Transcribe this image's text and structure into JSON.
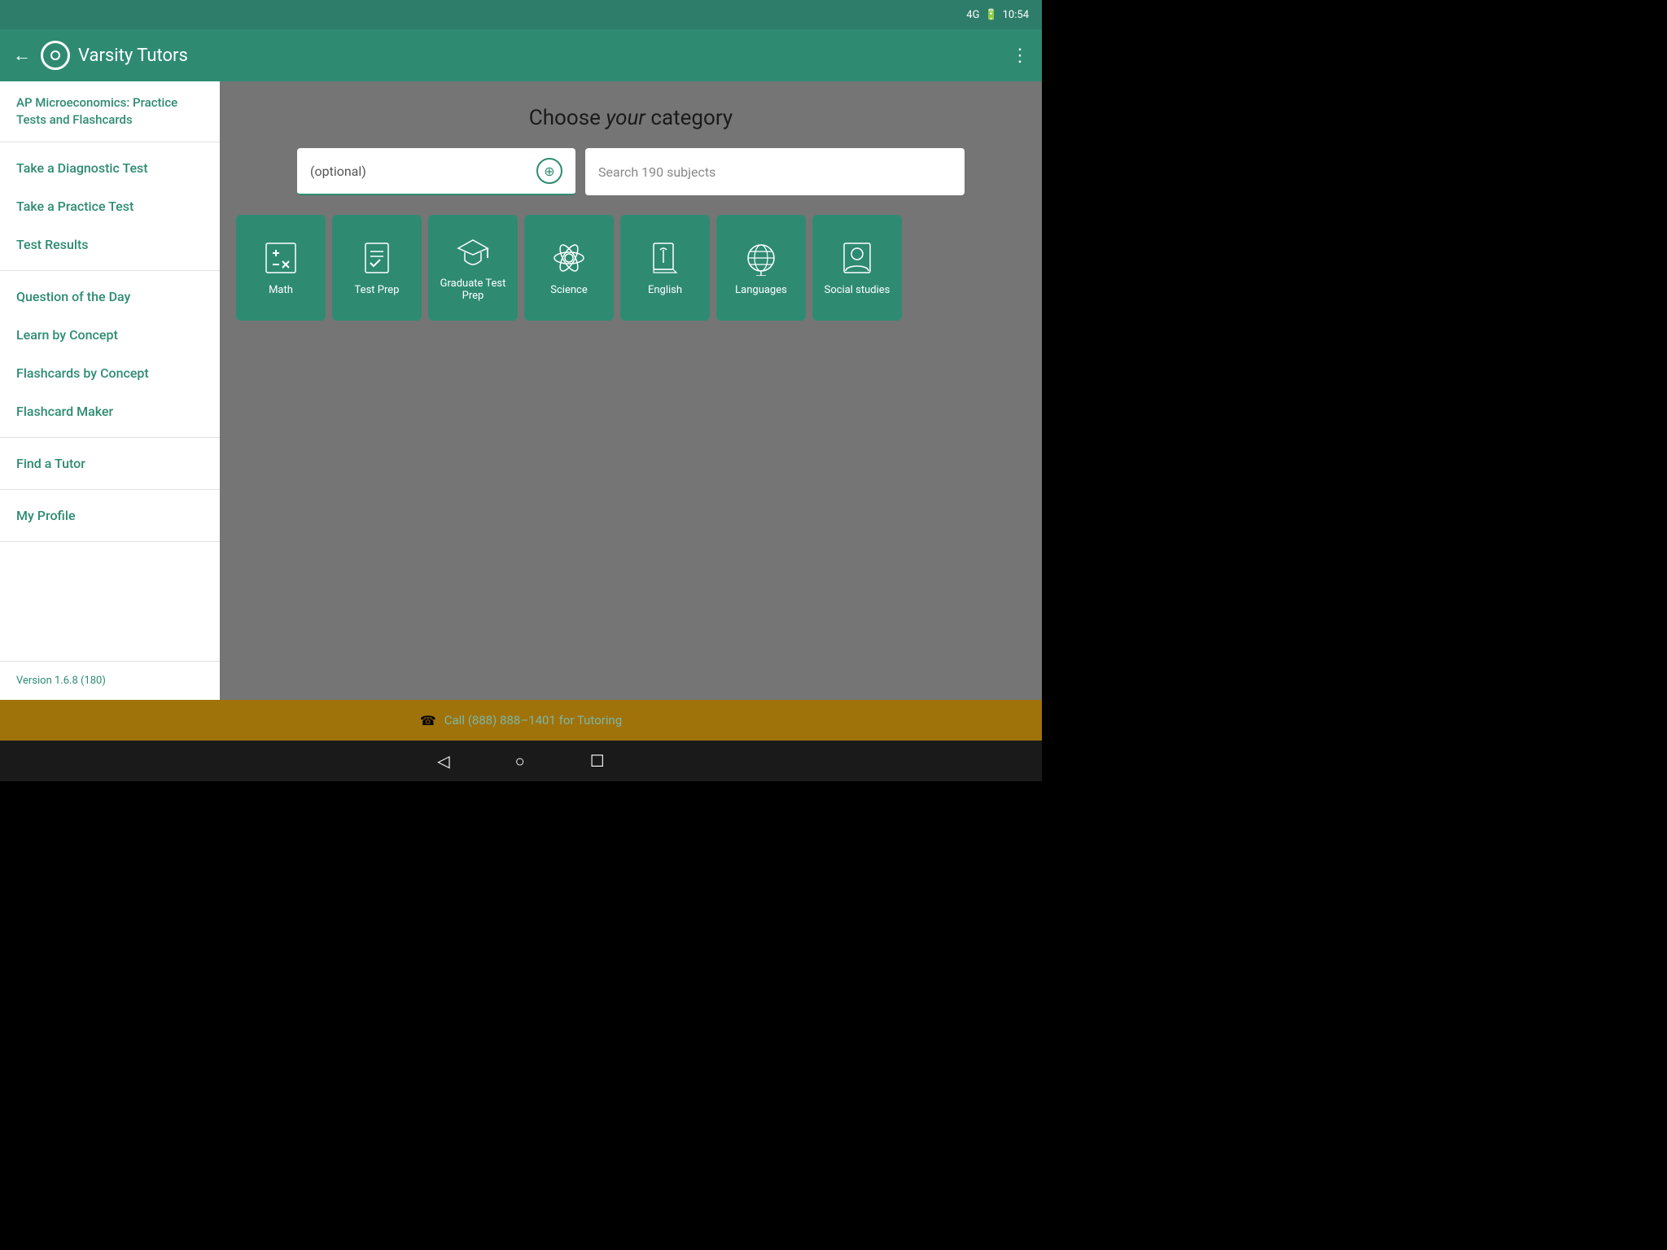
{
  "statusBar": {
    "signal": "4G",
    "time": "10:54"
  },
  "header": {
    "title": "Varsity Tutors",
    "back_label": "←",
    "more_label": "⋮"
  },
  "sidebar": {
    "header_text": "AP Microeconomics: Practice Tests and Flashcards",
    "items_section1": [
      {
        "label": "Take a Diagnostic Test"
      },
      {
        "label": "Take a Practice Test"
      },
      {
        "label": "Test Results"
      }
    ],
    "items_section2": [
      {
        "label": "Question of the Day"
      },
      {
        "label": "Learn by Concept"
      },
      {
        "label": "Flashcards by Concept"
      },
      {
        "label": "Flashcard Maker"
      }
    ],
    "items_section3": [
      {
        "label": "Find a Tutor"
      }
    ],
    "items_section4": [
      {
        "label": "My Profile"
      }
    ],
    "version": "Version 1.6.8 (180)"
  },
  "main": {
    "title_plain": "Choose ",
    "title_italic": "your",
    "title_suffix": " category",
    "search_left_placeholder": "(optional)",
    "search_right_placeholder": "Search 190 subjects",
    "categories": [
      {
        "label": "Math",
        "icon": "calc"
      },
      {
        "label": "Test Prep",
        "icon": "checklist"
      },
      {
        "label": "Graduate Test Prep",
        "icon": "grad"
      },
      {
        "label": "Science",
        "icon": "atom"
      },
      {
        "label": "English",
        "icon": "book"
      },
      {
        "label": "Languages",
        "icon": "globe"
      },
      {
        "label": "Social studies",
        "icon": "person"
      }
    ]
  },
  "bottomBar": {
    "phone_icon": "☎",
    "text": "Call (888) 888–1401 for Tutoring"
  },
  "navBar": {
    "back": "◁",
    "home": "○",
    "square": "☐"
  }
}
